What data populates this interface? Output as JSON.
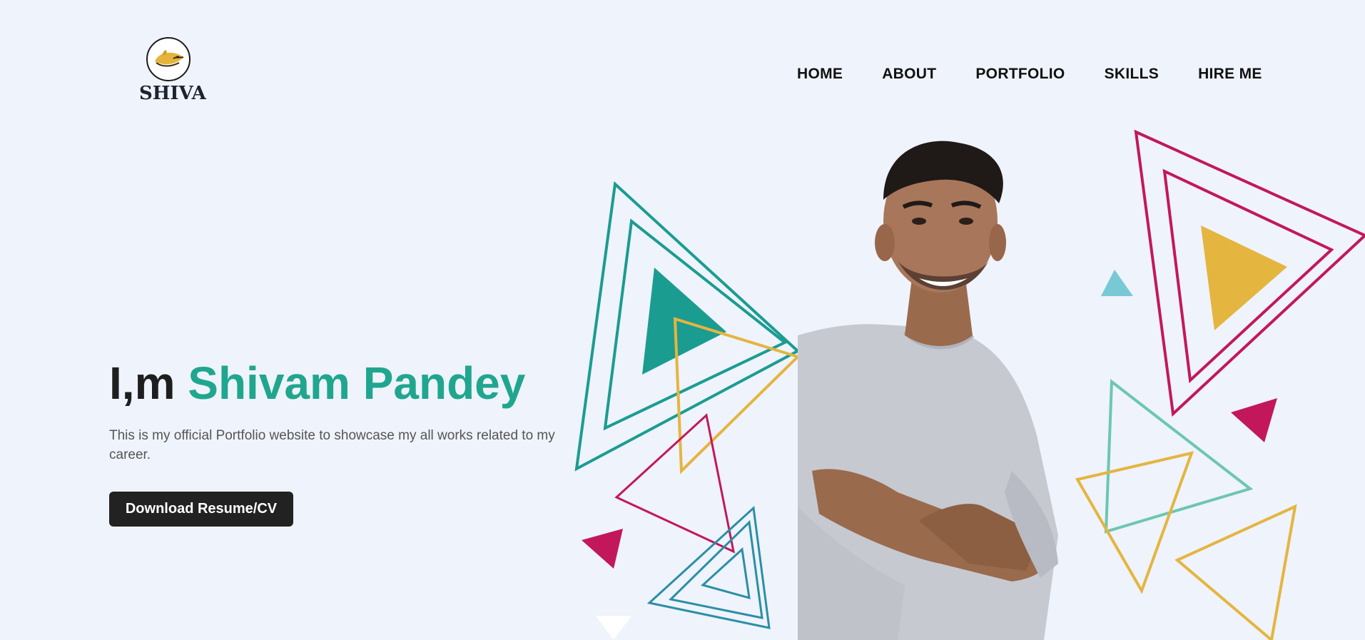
{
  "logo": {
    "text": "SHIVA",
    "icon": "fish-logo-icon"
  },
  "nav": {
    "items": [
      "HOME",
      "ABOUT",
      "PORTFOLIO",
      "SKILLS",
      "HIRE ME"
    ]
  },
  "hero": {
    "greeting": "I,m",
    "name": "Shivam Pandey",
    "description": "This is my official Portfolio website to showcase my all works related to my career.",
    "button_label": "Download Resume/CV"
  },
  "colors": {
    "background": "#eff3fb",
    "accent": "#20a68f",
    "teal": "#1b9c91",
    "crimson": "#c2185b",
    "gold": "#e4b53f",
    "sky": "#79c8d6",
    "button": "#222222"
  },
  "portrait": {
    "subject": "portrait-photo"
  }
}
